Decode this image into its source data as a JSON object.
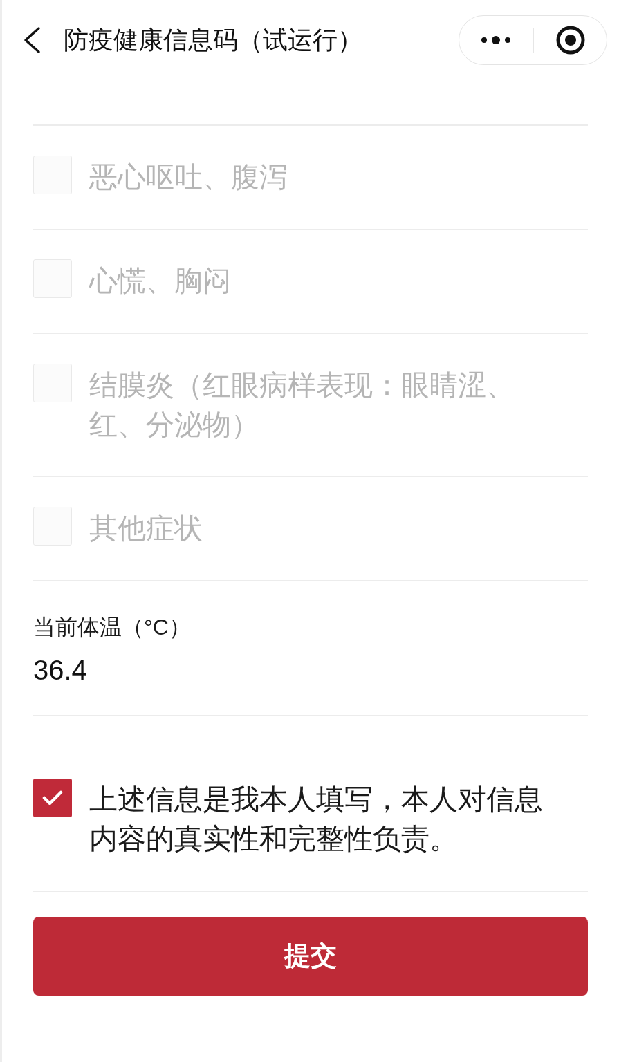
{
  "nav_bar": {
    "title": "防疫健康信息码（试运行）"
  },
  "symptoms": [
    {
      "label": "恶心呕吐、腹泻",
      "checked": false
    },
    {
      "label": "心慌、胸闷",
      "checked": false
    },
    {
      "label": "结膜炎（红眼病样表现：眼睛涩、红、分泌物）",
      "checked": false
    },
    {
      "label": "其他症状",
      "checked": false
    }
  ],
  "temperature": {
    "label": "当前体温（°C）",
    "value": "36.4"
  },
  "declaration": {
    "text": "上述信息是我本人填写，本人对信息内容的真实性和完整性负责。",
    "checked": true
  },
  "submit_button": {
    "label": "提交"
  }
}
